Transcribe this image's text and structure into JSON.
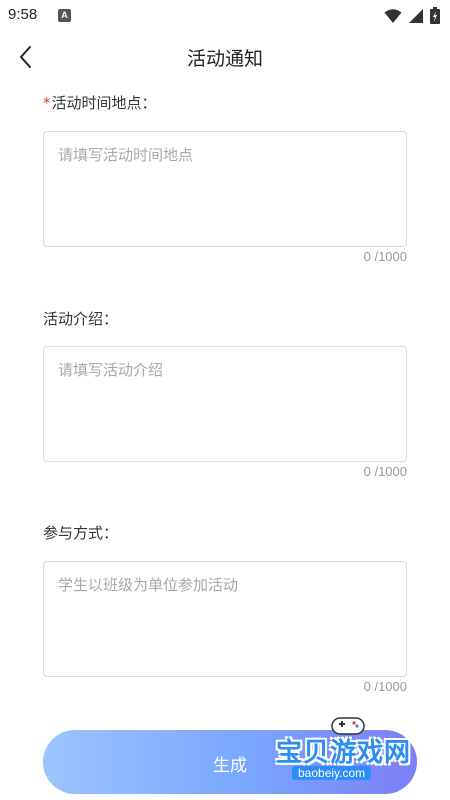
{
  "status_bar": {
    "time": "9:58",
    "notification_badge": "A"
  },
  "nav": {
    "title": "活动通知"
  },
  "fields": [
    {
      "required_mark": "*",
      "label": "活动时间地点：",
      "placeholder": "请填写活动时间地点",
      "counter": "0 /1000"
    },
    {
      "required_mark": "",
      "label": "活动介绍：",
      "placeholder": "请填写活动介绍",
      "counter": "0 /1000"
    },
    {
      "required_mark": "",
      "label": "参与方式：",
      "placeholder": "学生以班级为单位参加活动",
      "counter": "0 /1000"
    }
  ],
  "generate_button": {
    "label": "生成"
  },
  "watermark": {
    "title": "宝贝游戏网",
    "url": "baobeiy.com"
  },
  "colors": {
    "required": "#e23b3b",
    "button_start": "#9cc4ff",
    "button_end": "#7d7ef5",
    "watermark": "#2b8df5"
  }
}
